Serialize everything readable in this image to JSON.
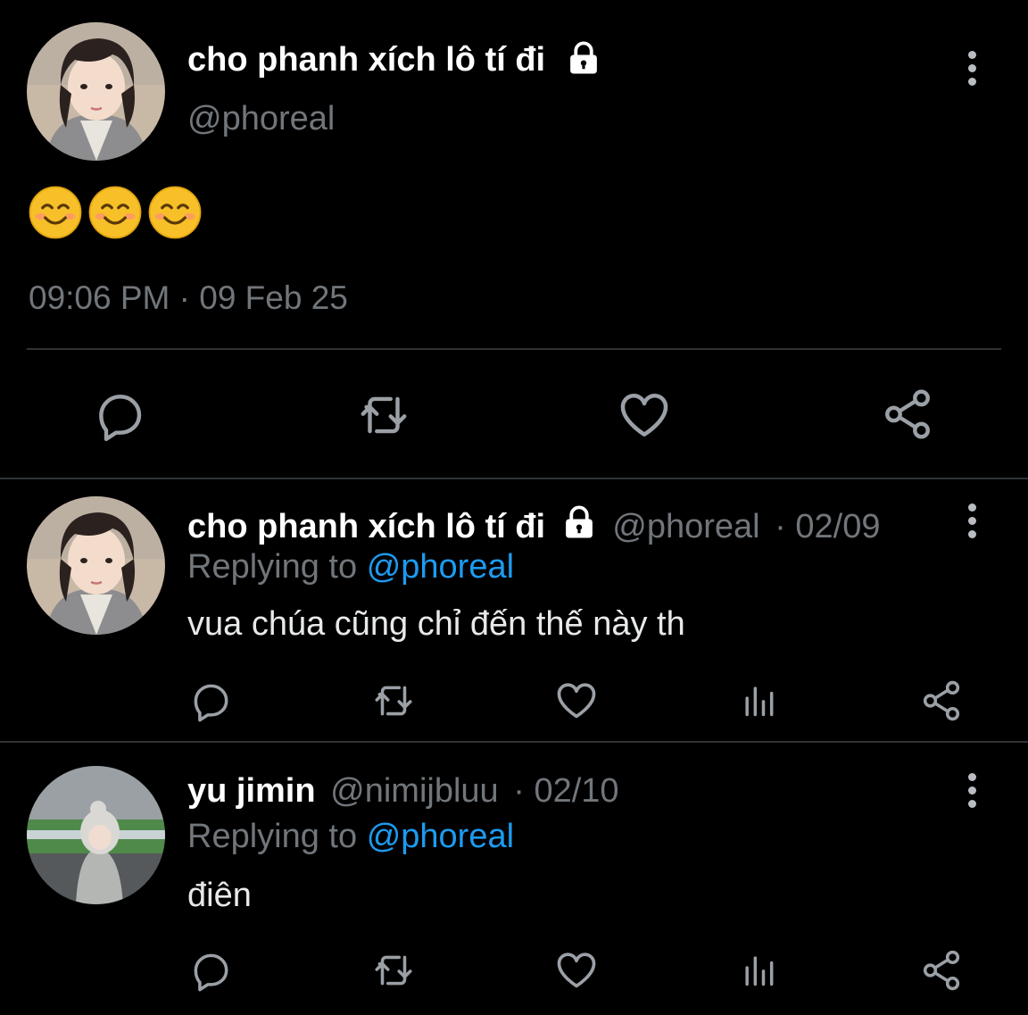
{
  "main_tweet": {
    "display_name": "cho phanh xích lô tí đi",
    "handle": "@phoreal",
    "content": "😊😊😊",
    "timestamp": "09:06 PM · 09 Feb 25",
    "actions": [
      "reply-icon",
      "retweet-icon",
      "like-icon",
      "share-icon"
    ]
  },
  "replies": [
    {
      "display_name": "cho phanh xích lô tí đi",
      "handle": "@phoreal",
      "date": "· 02/09",
      "replying_prefix": "Replying to",
      "replying_to": "@phoreal",
      "content": "vua chúa cũng chỉ đến thế này th",
      "actions": [
        "reply-icon",
        "retweet-icon",
        "like-icon",
        "analytics-icon",
        "share-icon"
      ]
    },
    {
      "display_name": "yu jimin",
      "handle": "@nimijbluu",
      "date": "· 02/10",
      "replying_prefix": "Replying to",
      "replying_to": "@phoreal",
      "content": "điên",
      "actions": [
        "reply-icon",
        "retweet-icon",
        "like-icon",
        "analytics-icon",
        "share-icon"
      ]
    }
  ],
  "colors": {
    "background": "#000000",
    "muted": "#71767b",
    "accent": "#1d9bf0",
    "divider": "#2f3336"
  }
}
